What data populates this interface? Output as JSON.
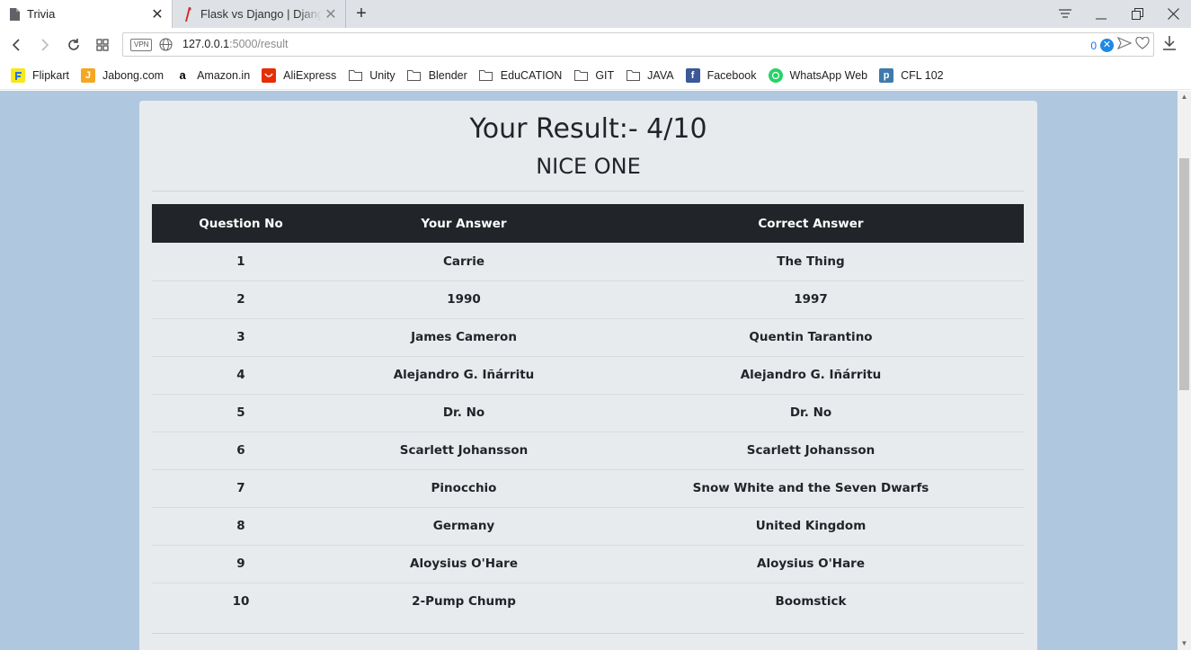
{
  "browser": {
    "tabs": [
      {
        "title": "Trivia",
        "active": true
      },
      {
        "title": "Flask vs Django | Django Fl",
        "active": false
      }
    ],
    "new_tab_label": "+",
    "address": {
      "vpn_label": "VPN",
      "host": "127.0.0.1",
      "path": ":5000/result",
      "blocked_count": "0"
    },
    "bookmarks": [
      {
        "label": "Flipkart",
        "icon": "flipkart-icon",
        "color": "#2874f0"
      },
      {
        "label": "Jabong.com",
        "icon": "jabong-icon",
        "color": "#f5a623"
      },
      {
        "label": "Amazon.in",
        "icon": "amazon-icon",
        "color": "#000000"
      },
      {
        "label": "AliExpress",
        "icon": "aliexpress-icon",
        "color": "#e62e04"
      },
      {
        "label": "Unity",
        "icon": "folder-icon"
      },
      {
        "label": "Blender",
        "icon": "folder-icon"
      },
      {
        "label": "EduCATION",
        "icon": "folder-icon"
      },
      {
        "label": "GIT",
        "icon": "folder-icon"
      },
      {
        "label": "JAVA",
        "icon": "folder-icon"
      },
      {
        "label": "Facebook",
        "icon": "facebook-icon",
        "color": "#3b5998"
      },
      {
        "label": "WhatsApp Web",
        "icon": "whatsapp-icon",
        "color": "#25d366"
      },
      {
        "label": "CFL 102",
        "icon": "piazza-icon",
        "color": "#3e7aab"
      }
    ]
  },
  "page": {
    "title": "Your Result:- 4/10",
    "subtitle": "NICE ONE",
    "table": {
      "headers": [
        "Question No",
        "Your Answer",
        "Correct Answer"
      ],
      "rows": [
        [
          "1",
          "Carrie",
          "The Thing"
        ],
        [
          "2",
          "1990",
          "1997"
        ],
        [
          "3",
          "James Cameron",
          "Quentin Tarantino"
        ],
        [
          "4",
          "Alejandro G. Iñárritu",
          "Alejandro G. Iñárritu"
        ],
        [
          "5",
          "Dr. No",
          "Dr. No"
        ],
        [
          "6",
          "Scarlett Johansson",
          "Scarlett Johansson"
        ],
        [
          "7",
          "Pinocchio",
          "Snow White and the Seven Dwarfs"
        ],
        [
          "8",
          "Germany",
          "United Kingdom"
        ],
        [
          "9",
          "Aloysius O'Hare",
          "Aloysius O'Hare"
        ],
        [
          "10",
          "2-Pump Chump",
          "Boomstick"
        ]
      ]
    }
  },
  "colors": {
    "page_background": "#b0c7e0",
    "card_background": "#e8ebee",
    "table_header": "#212529"
  }
}
